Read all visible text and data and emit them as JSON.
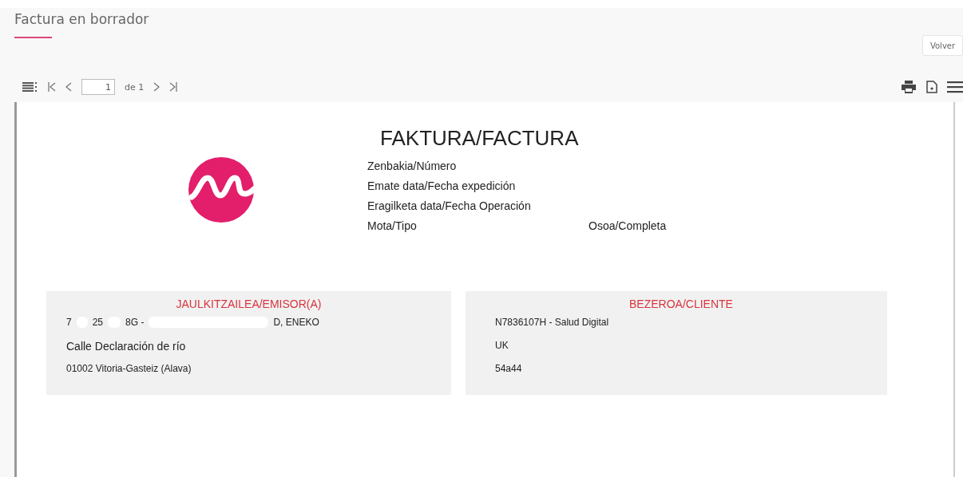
{
  "header": {
    "title": "Factura en borrador",
    "back_button": "Volver"
  },
  "toolbar": {
    "page": "1",
    "page_count": "de 1"
  },
  "document": {
    "title": "FAKTURA/FACTURA",
    "fields": [
      {
        "label": "Zenbakia/Número"
      },
      {
        "label": "Emate data/Fecha expedición"
      },
      {
        "label": "Eragilketa data/Fecha Operación"
      },
      {
        "label": "Mota/Tipo",
        "value": "Osoa/Completa"
      }
    ],
    "parties": [
      {
        "heading": "JAULKITZAILEA/EMISOR(A)",
        "lines": [
          {
            "kind": "redacted",
            "parts": [
              "7",
              "25",
              "8G -",
              "D, ENEKO"
            ]
          },
          {
            "kind": "large",
            "text": "Calle Declaración de río"
          },
          {
            "kind": "small",
            "text": "01002 Vitoria-Gasteiz (Alava)"
          }
        ]
      },
      {
        "heading": "BEZEROA/CLIENTE",
        "lines": [
          {
            "kind": "small",
            "text": "N7836107H - Salud Digital"
          },
          {
            "kind": "small",
            "text": "UK"
          },
          {
            "kind": "small",
            "text": "54a44"
          }
        ]
      }
    ]
  }
}
